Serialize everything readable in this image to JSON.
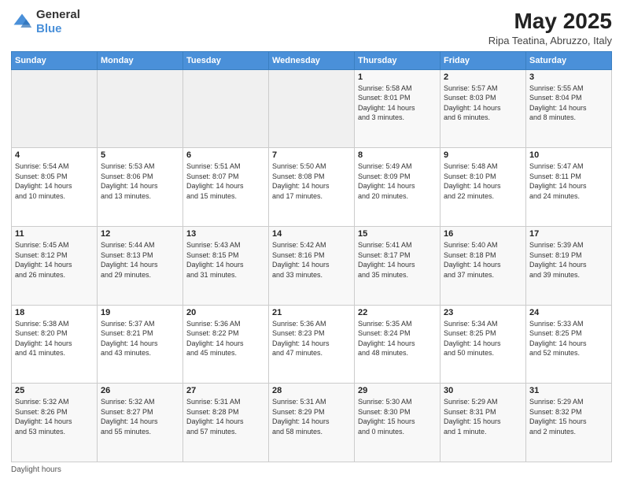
{
  "header": {
    "logo_line1": "General",
    "logo_line2": "Blue",
    "month_title": "May 2025",
    "subtitle": "Ripa Teatina, Abruzzo, Italy"
  },
  "weekdays": [
    "Sunday",
    "Monday",
    "Tuesday",
    "Wednesday",
    "Thursday",
    "Friday",
    "Saturday"
  ],
  "footer": {
    "note": "Daylight hours"
  },
  "weeks": [
    [
      {
        "day": "",
        "info": ""
      },
      {
        "day": "",
        "info": ""
      },
      {
        "day": "",
        "info": ""
      },
      {
        "day": "",
        "info": ""
      },
      {
        "day": "1",
        "info": "Sunrise: 5:58 AM\nSunset: 8:01 PM\nDaylight: 14 hours\nand 3 minutes."
      },
      {
        "day": "2",
        "info": "Sunrise: 5:57 AM\nSunset: 8:03 PM\nDaylight: 14 hours\nand 6 minutes."
      },
      {
        "day": "3",
        "info": "Sunrise: 5:55 AM\nSunset: 8:04 PM\nDaylight: 14 hours\nand 8 minutes."
      }
    ],
    [
      {
        "day": "4",
        "info": "Sunrise: 5:54 AM\nSunset: 8:05 PM\nDaylight: 14 hours\nand 10 minutes."
      },
      {
        "day": "5",
        "info": "Sunrise: 5:53 AM\nSunset: 8:06 PM\nDaylight: 14 hours\nand 13 minutes."
      },
      {
        "day": "6",
        "info": "Sunrise: 5:51 AM\nSunset: 8:07 PM\nDaylight: 14 hours\nand 15 minutes."
      },
      {
        "day": "7",
        "info": "Sunrise: 5:50 AM\nSunset: 8:08 PM\nDaylight: 14 hours\nand 17 minutes."
      },
      {
        "day": "8",
        "info": "Sunrise: 5:49 AM\nSunset: 8:09 PM\nDaylight: 14 hours\nand 20 minutes."
      },
      {
        "day": "9",
        "info": "Sunrise: 5:48 AM\nSunset: 8:10 PM\nDaylight: 14 hours\nand 22 minutes."
      },
      {
        "day": "10",
        "info": "Sunrise: 5:47 AM\nSunset: 8:11 PM\nDaylight: 14 hours\nand 24 minutes."
      }
    ],
    [
      {
        "day": "11",
        "info": "Sunrise: 5:45 AM\nSunset: 8:12 PM\nDaylight: 14 hours\nand 26 minutes."
      },
      {
        "day": "12",
        "info": "Sunrise: 5:44 AM\nSunset: 8:13 PM\nDaylight: 14 hours\nand 29 minutes."
      },
      {
        "day": "13",
        "info": "Sunrise: 5:43 AM\nSunset: 8:15 PM\nDaylight: 14 hours\nand 31 minutes."
      },
      {
        "day": "14",
        "info": "Sunrise: 5:42 AM\nSunset: 8:16 PM\nDaylight: 14 hours\nand 33 minutes."
      },
      {
        "day": "15",
        "info": "Sunrise: 5:41 AM\nSunset: 8:17 PM\nDaylight: 14 hours\nand 35 minutes."
      },
      {
        "day": "16",
        "info": "Sunrise: 5:40 AM\nSunset: 8:18 PM\nDaylight: 14 hours\nand 37 minutes."
      },
      {
        "day": "17",
        "info": "Sunrise: 5:39 AM\nSunset: 8:19 PM\nDaylight: 14 hours\nand 39 minutes."
      }
    ],
    [
      {
        "day": "18",
        "info": "Sunrise: 5:38 AM\nSunset: 8:20 PM\nDaylight: 14 hours\nand 41 minutes."
      },
      {
        "day": "19",
        "info": "Sunrise: 5:37 AM\nSunset: 8:21 PM\nDaylight: 14 hours\nand 43 minutes."
      },
      {
        "day": "20",
        "info": "Sunrise: 5:36 AM\nSunset: 8:22 PM\nDaylight: 14 hours\nand 45 minutes."
      },
      {
        "day": "21",
        "info": "Sunrise: 5:36 AM\nSunset: 8:23 PM\nDaylight: 14 hours\nand 47 minutes."
      },
      {
        "day": "22",
        "info": "Sunrise: 5:35 AM\nSunset: 8:24 PM\nDaylight: 14 hours\nand 48 minutes."
      },
      {
        "day": "23",
        "info": "Sunrise: 5:34 AM\nSunset: 8:25 PM\nDaylight: 14 hours\nand 50 minutes."
      },
      {
        "day": "24",
        "info": "Sunrise: 5:33 AM\nSunset: 8:25 PM\nDaylight: 14 hours\nand 52 minutes."
      }
    ],
    [
      {
        "day": "25",
        "info": "Sunrise: 5:32 AM\nSunset: 8:26 PM\nDaylight: 14 hours\nand 53 minutes."
      },
      {
        "day": "26",
        "info": "Sunrise: 5:32 AM\nSunset: 8:27 PM\nDaylight: 14 hours\nand 55 minutes."
      },
      {
        "day": "27",
        "info": "Sunrise: 5:31 AM\nSunset: 8:28 PM\nDaylight: 14 hours\nand 57 minutes."
      },
      {
        "day": "28",
        "info": "Sunrise: 5:31 AM\nSunset: 8:29 PM\nDaylight: 14 hours\nand 58 minutes."
      },
      {
        "day": "29",
        "info": "Sunrise: 5:30 AM\nSunset: 8:30 PM\nDaylight: 15 hours\nand 0 minutes."
      },
      {
        "day": "30",
        "info": "Sunrise: 5:29 AM\nSunset: 8:31 PM\nDaylight: 15 hours\nand 1 minute."
      },
      {
        "day": "31",
        "info": "Sunrise: 5:29 AM\nSunset: 8:32 PM\nDaylight: 15 hours\nand 2 minutes."
      }
    ]
  ]
}
